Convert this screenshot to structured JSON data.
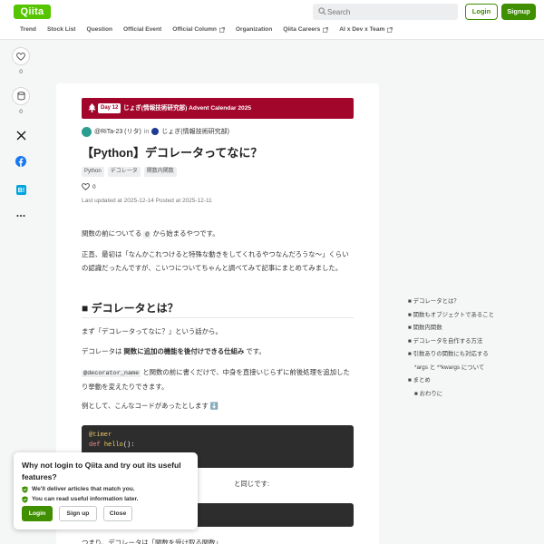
{
  "header": {
    "logo": "Qiita",
    "search_placeholder": "Search",
    "login_label": "Login",
    "signup_label": "Signup",
    "nav": [
      "Trend",
      "Stock List",
      "Question",
      "Official Event",
      "Official Column",
      "Organization",
      "Qiita Careers",
      "AI x Dev x Team"
    ]
  },
  "sidebar": {
    "like_count": "0",
    "stock_count": "0",
    "icons": [
      "heart-icon",
      "stock-icon",
      "x-icon",
      "facebook-icon",
      "hatena-icon",
      "more-icon"
    ]
  },
  "article": {
    "banner": {
      "day": "Day 12",
      "calendar": "じょぎ(情報技術研究部) Advent Calendar 2025"
    },
    "author": "@RiTa-23 (リタ)",
    "in_label": "in",
    "organization": "じょぎ(情報技術研究部)",
    "title": "【Python】デコレータってなに？",
    "tags": [
      "Python",
      "デコレータ",
      "関数内関数"
    ],
    "like_count": "0",
    "dates": "Last updated at 2025-12-14   Posted at 2025-12-11",
    "intro_1_before": "関数の前についてる ",
    "intro_1_code": "@",
    "intro_1_after": " から始まるやつです。",
    "intro_2": "正直、最初は「なんかこれつけると特殊な動きをしてくれるやつなんだろうな〜」くらいの認識だったんですが、こいつについてちゃんと調べてみて記事にまとめてみました。",
    "section_heading": "■ デコレータとは？",
    "p1": "まず「デコレータってなに？」という話から。",
    "p2_before": "デコレータは ",
    "p2_bold": "関数に追加の機能を後付けできる仕組み",
    "p2_after": " です。",
    "p3_code": "@decorator_name",
    "p3_text": " と関数の前に書くだけで、中身を直接いじらずに前後処理を追加したり挙動を変えたりできます。",
    "p4": "例として、こんなコードがあったとします ⬇️",
    "code1_line1": "@timer",
    "code1_kw": "def",
    "code1_fn": "hello",
    "code1_rest": "():",
    "p5": "と同じです:",
    "p6": "つまり、デコレータは「関数を受け取る関数」"
  },
  "toc": [
    {
      "label": "■ デコレータとは？",
      "level": 1
    },
    {
      "label": "■ 関数もオブジェクトであること",
      "level": 1
    },
    {
      "label": "■ 関数内関数",
      "level": 1
    },
    {
      "label": "■ デコレータを自作する方法",
      "level": 1
    },
    {
      "label": "■ 引数ありの関数にも対応する",
      "level": 1
    },
    {
      "label": "*args と **kwargs について",
      "level": 2
    },
    {
      "label": "■ まとめ",
      "level": 1
    },
    {
      "label": "■ おわりに",
      "level": 2
    }
  ],
  "popup": {
    "title": "Why not login to Qiita and try out its useful features?",
    "benefit_1": "We'll deliver articles that match you.",
    "benefit_2": "You can read useful information later.",
    "login_label": "Login",
    "signup_label": "Sign up",
    "close_label": "Close"
  },
  "colors": {
    "brand": "#55c500",
    "button_green": "#3f8f00",
    "banner": "#a3062b"
  }
}
